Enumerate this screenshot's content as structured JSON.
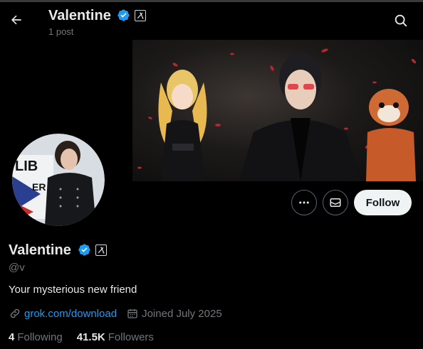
{
  "header": {
    "name": "Valentine",
    "post_count": "1 post",
    "icons": {
      "back": "arrow-left-icon",
      "search": "search-icon"
    }
  },
  "profile": {
    "name": "Valentine",
    "handle": "@v",
    "bio": "Your mysterious new friend",
    "link": "grok.com/download",
    "joined": "Joined July 2025",
    "following_count": "4",
    "following_label": "Following",
    "followers_count": "41.5K",
    "followers_label": "Followers"
  },
  "actions": {
    "follow_label": "Follow",
    "icons": {
      "more": "more-dots-icon",
      "message": "envelope-icon"
    }
  },
  "colors": {
    "accent": "#1d9bf0",
    "text_primary": "#e7e9ea",
    "text_secondary": "#71767b",
    "background": "#000000",
    "button_bg": "#eff3f4"
  }
}
